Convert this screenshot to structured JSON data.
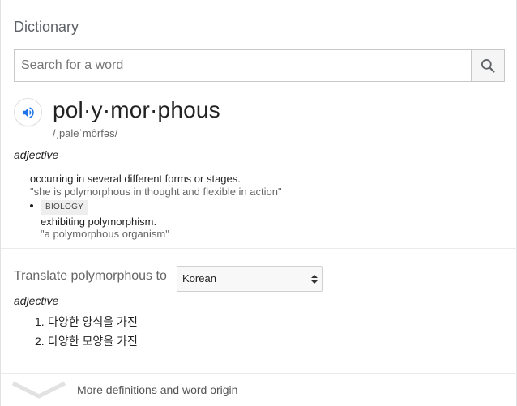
{
  "header": {
    "title": "Dictionary"
  },
  "search": {
    "placeholder": "Search for a word",
    "value": ""
  },
  "entry": {
    "word": "pol·y·mor·phous",
    "pronunciation": "/ˌpälēˈmôrfəs/",
    "part_of_speech": "adjective",
    "senses": [
      {
        "definition": "occurring in several different forms or stages.",
        "example": "\"she is polymorphous in thought and flexible in action\""
      },
      {
        "domain": "BIOLOGY",
        "definition": "exhibiting polymorphism.",
        "example": "\"a polymorphous organism\""
      }
    ]
  },
  "translate": {
    "label": "Translate polymorphous to",
    "language": "Korean",
    "part_of_speech": "adjective",
    "items": [
      {
        "num": "1.",
        "text": "다양한 양식을 가진"
      },
      {
        "num": "2.",
        "text": "다양한 모양을 가진"
      }
    ]
  },
  "footer": {
    "more_label": "More definitions and word origin"
  },
  "colors": {
    "speaker": "#1a73e8",
    "search_icon": "#5f6368",
    "muted_text": "#666666"
  }
}
